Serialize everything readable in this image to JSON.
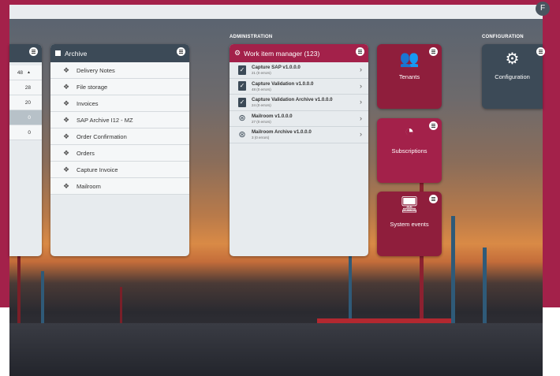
{
  "topbar": {
    "badge": "F"
  },
  "sections": {
    "administration": "ADMINISTRATION",
    "configuration": "CONFIGURATION"
  },
  "left_panel": {
    "rows": [
      "48",
      "28",
      "20",
      "0",
      "0"
    ]
  },
  "archive": {
    "title": "Archive",
    "items": [
      "Delivery Notes",
      "File storage",
      "Invoices",
      "SAP Archive I12 - MZ",
      "Order Confirmation",
      "Orders",
      "Capture Invoice",
      "Mailroom"
    ]
  },
  "work_items": {
    "title": "Work item manager (123)",
    "items": [
      {
        "title": "Capture SAP v1.0.0.0",
        "sub": "21 (0 errors)",
        "icon": "checkbox-icon"
      },
      {
        "title": "Capture Validation v1.0.0.0",
        "sub": "48 (0 errors)",
        "icon": "checkbox-icon"
      },
      {
        "title": "Capture Validation Archive v1.0.0.0",
        "sub": "24 (0 errors)",
        "icon": "checkbox-icon"
      },
      {
        "title": "Mailroom v1.0.0.0",
        "sub": "27 (0 errors)",
        "icon": "robot-icon"
      },
      {
        "title": "Mailroom Archive v1.0.0.0",
        "sub": "3 (0 errors)",
        "icon": "robot-icon"
      }
    ]
  },
  "tiles": {
    "tenants": "Tenants",
    "subscriptions": "Subscriptions",
    "system_events": "System events",
    "configuration": "Configuration"
  },
  "colors": {
    "crimson": "#a3214a",
    "tile_red": "#8f1e3c",
    "dark_slate": "#3c4a57"
  }
}
